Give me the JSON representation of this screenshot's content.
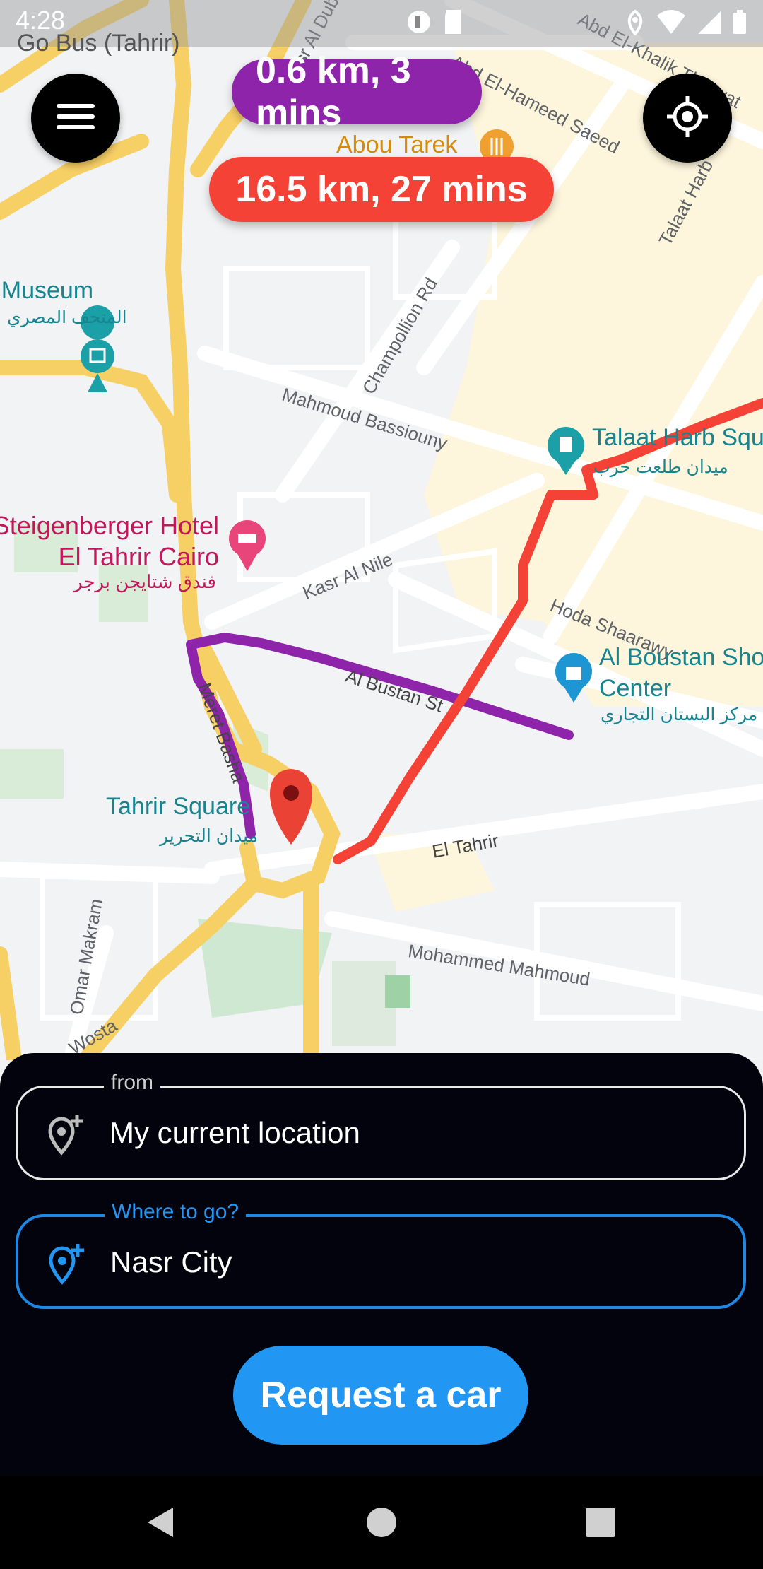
{
  "status_bar": {
    "time": "4:28",
    "icons": [
      "app-notification-icon",
      "sd-card-icon",
      "location-icon",
      "wifi-icon",
      "signal-icon",
      "battery-icon"
    ]
  },
  "app_title": "Go Bus (Tahrir)",
  "map": {
    "streets": [
      "Qasr Al Dubara",
      "Abd El-Khalik Tharwat",
      "Abd El-Hameed Saeed",
      "Talaat Harb",
      "Champollion Rd",
      "Mahmoud Bassiouny",
      "Kasr Al Nile",
      "Hoda Shaarawy",
      "Al Bustan St",
      "Meret Basha",
      "El Tahrir",
      "Mohammed Mahmoud",
      "Omar Makram",
      "Wosta"
    ],
    "pois": [
      {
        "name": "Abou Tarek",
        "icon": "restaurant-icon"
      },
      {
        "name": "Egyptian Museum",
        "name_ar": "المتحف المصري",
        "icon": "museum-icon"
      },
      {
        "name": "Talaat Harb Square",
        "name_ar": "ميدان طلعت حرب",
        "icon": "monument-icon"
      },
      {
        "name": "Steigenberger Hotel El Tahrir Cairo",
        "name_ar": "فندق شتايجن برجر",
        "icon": "hotel-icon"
      },
      {
        "name": "Al Boustan Shopping Center",
        "name_ar": "مركز البستان التجاري",
        "icon": "shopping-bag-icon"
      },
      {
        "name": "Tahrir Square",
        "name_ar": "ميدان التحرير",
        "icon": "monument-icon"
      }
    ],
    "route_colors": {
      "walking": "#8e24aa",
      "driving": "#f44336"
    }
  },
  "top_controls": {
    "menu_icon": "menu-icon",
    "locate_icon": "my-location-icon"
  },
  "routes": {
    "walking_summary": "0.6 km, 3 mins",
    "driving_summary": "16.5 km, 27 mins"
  },
  "sheet": {
    "from": {
      "label": "from",
      "value": "My current location",
      "icon": "add-location-icon"
    },
    "to": {
      "label": "Where to go?",
      "value": "Nasr City",
      "icon": "add-location-icon"
    },
    "request_button": "Request a car"
  },
  "nav_bar": [
    "back-icon",
    "home-icon",
    "recents-icon"
  ],
  "colors": {
    "accent": "#2196f3",
    "sheet_bg": "#03030d",
    "walking": "#8e24aa",
    "driving": "#f44336"
  }
}
